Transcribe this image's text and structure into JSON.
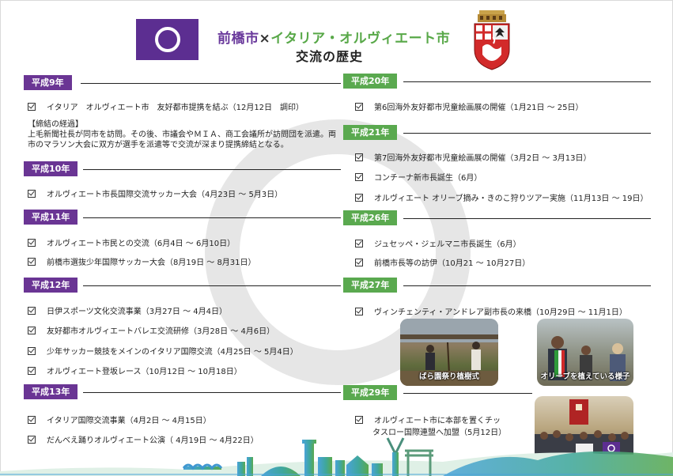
{
  "header": {
    "title_maebashi": "前橋市",
    "title_x": "×",
    "title_orvieto": "イタリア・オルヴィエート市",
    "subtitle": "交流の歴史"
  },
  "colors": {
    "purple": "#6a3594",
    "green": "#5aa94f",
    "ring": "#e6e6e6"
  },
  "left": [
    {
      "era": "平成9年",
      "items": [
        "イタリア　オルヴィエート市　友好都市提携を結ぶ（12月12日　調印）"
      ]
    },
    {
      "era": "平成10年",
      "items": [
        "オルヴィエート市長国際交流サッカー大会（4月23日 ～ 5月3日）"
      ]
    },
    {
      "era": "平成11年",
      "items": [
        "オルヴィエート市民との交流（6月4日 ～ 6月10日）",
        "前橋市選抜少年国際サッカー大会（8月19日 ～ 8月31日）"
      ]
    },
    {
      "era": "平成12年",
      "items": [
        "日伊スポーツ文化交流事業（3月27日 ～ 4月4日）",
        "友好都市オルヴィエートバレエ交流研修（3月28日 ～ 4月6日）",
        "少年サッカー競技をメインのイタリア国際交流（4月25日 ～ 5月4日）",
        "オルヴィエート登坂レース（10月12日 ～ 10月18日）"
      ]
    },
    {
      "era": "平成13年",
      "items": [
        "イタリア国際交流事業（4月2日 ～ 4月15日）",
        "だんべえ踊りオルヴィエート公演（ 4月19日 ～ 4月22日）"
      ]
    }
  ],
  "note": {
    "heading": "【締結の経過】",
    "body": "上毛新聞社長が同市を訪問。その後、市議会やＭＩＡ、商工会議所が訪問団を派遣。両市のマラソン大会に双方が選手を派遣等で交流が深まり提携締結となる。"
  },
  "right": [
    {
      "era": "平成20年",
      "items": [
        "第6回海外友好都市児童絵画展の開催（1月21日 ～ 25日）"
      ]
    },
    {
      "era": "平成21年",
      "items": [
        "第7回海外友好都市児童絵画展の開催（3月2日 ～ 3月13日）",
        "コンチーナ新市長誕生（6月）",
        "オルヴィエート オリーブ摘み・きのこ狩りツアー実施（11月13日 ～ 19日）"
      ]
    },
    {
      "era": "平成26年",
      "items": [
        "ジュセッペ・ジェルマニ市長誕生（6月）",
        "前橋市長等の訪伊（10月21 ～ 10月27日）"
      ]
    },
    {
      "era": "平成27年",
      "items": [
        "ヴィンチェンティ・アンドレア副市長の来橋（10月29日 ～ 11月1日）"
      ]
    },
    {
      "era": "平成29年",
      "items": [
        "オルヴィエート市に本部を置くチッ",
        "タスロー国際連盟へ加盟（5月12日）"
      ]
    }
  ],
  "photos": {
    "rose_caption": "ばら園祭り植樹式",
    "olive_caption": "オリーブを植えている様子"
  }
}
